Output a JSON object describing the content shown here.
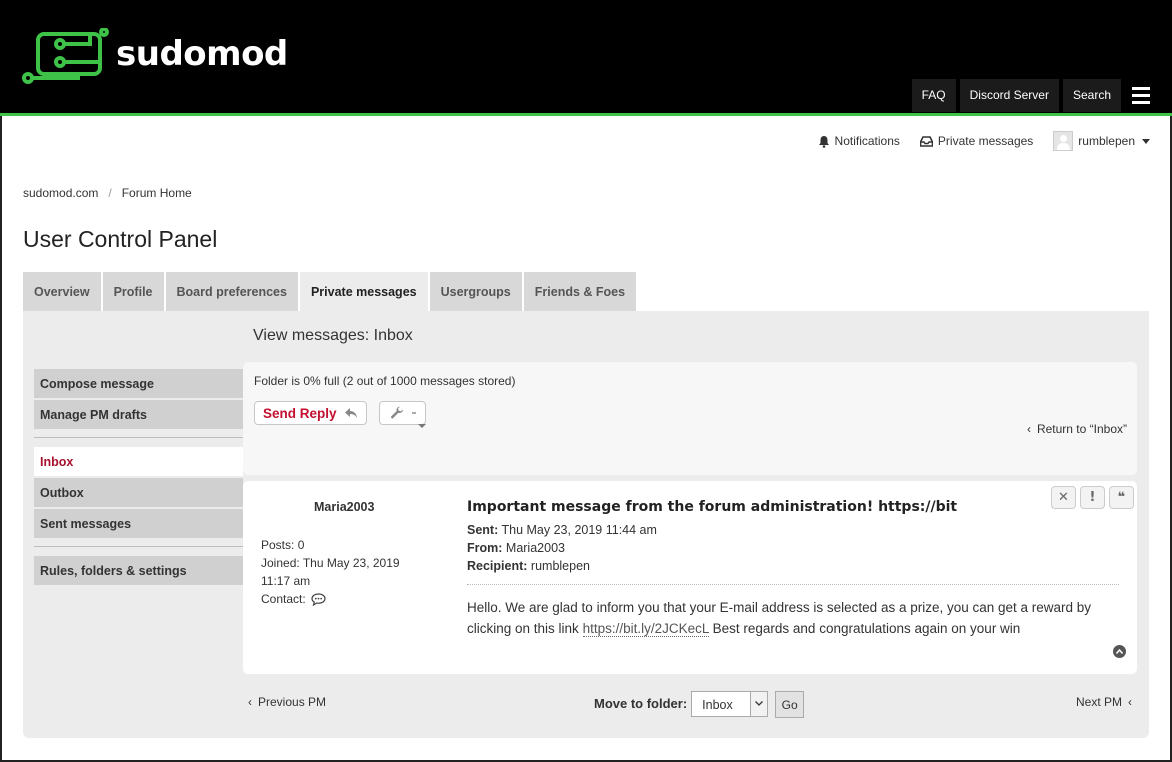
{
  "brand": {
    "logo_text": "sudomod",
    "accent": "#3ec348"
  },
  "topnav": {
    "items": [
      "FAQ",
      "Discord Server",
      "Search"
    ],
    "menu_icon": "hamburger-icon"
  },
  "userbar": {
    "notifications": "Notifications",
    "private_messages": "Private messages",
    "username": "rumblepen"
  },
  "breadcrumb": {
    "items": [
      "sudomod.com",
      "Forum Home"
    ],
    "separator": "/"
  },
  "page": {
    "title": "User Control Panel"
  },
  "tabs": [
    "Overview",
    "Profile",
    "Board preferences",
    "Private messages",
    "Usergroups",
    "Friends & Foes"
  ],
  "active_tab": "Private messages",
  "sidemenu": {
    "group1": [
      "Compose message",
      "Manage PM drafts"
    ],
    "group2": [
      "Inbox",
      "Outbox",
      "Sent messages"
    ],
    "group3": [
      "Rules, folders & settings"
    ],
    "active": "Inbox"
  },
  "view": {
    "title": "View messages: Inbox"
  },
  "folder": {
    "status": "Folder is 0% full (2 out of 1000 messages stored)",
    "send_reply": "Send Reply",
    "return_link": "Return to “Inbox”"
  },
  "message": {
    "author": "Maria2003",
    "posts_label": "Posts:",
    "posts": "0",
    "joined_label": "Joined:",
    "joined": "Thu May 23, 2019 11:17 am",
    "contact_label": "Contact:",
    "title": "Important message from the forum administration! https://bit",
    "sent_label": "Sent:",
    "sent": "Thu May 23, 2019 11:44 am",
    "from_label": "From:",
    "from": "Maria2003",
    "recipient_label": "Recipient:",
    "recipient": "rumblepen",
    "body_before": "Hello. We are glad to inform you that your E-mail address is selected as a prize, you can get a reward by clicking on this link ",
    "body_link": "https://bit.ly/2JCKecL",
    "body_after": " Best regards and congratulations again on your win"
  },
  "bottom": {
    "previous": "Previous PM",
    "next": "Next PM",
    "move_label": "Move to folder:",
    "folder_selected": "Inbox",
    "go": "Go"
  },
  "colors": {
    "header_bg": "#000000",
    "brand_red": "#c3102f",
    "panel_bg": "#ececec"
  }
}
